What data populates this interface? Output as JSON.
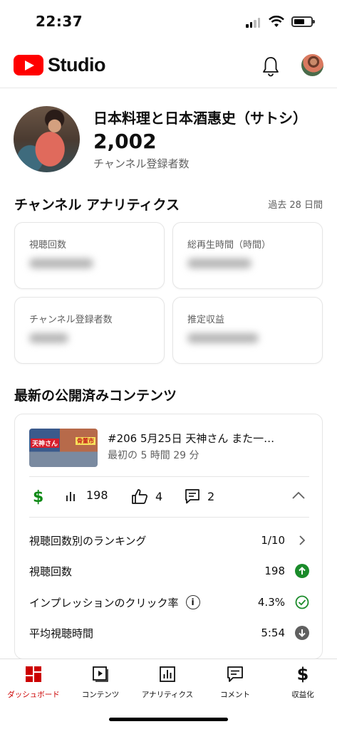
{
  "status_bar": {
    "time": "22:37"
  },
  "header": {
    "logo_text": "Studio"
  },
  "channel": {
    "name": "日本料理と日本酒惠史（サトシ）",
    "subscriber_count": "2,002",
    "subscriber_label": "チャンネル登録者数"
  },
  "analytics": {
    "title": "チャンネル アナリティクス",
    "period": "過去 28 日間",
    "cards": [
      {
        "label": "視聴回数"
      },
      {
        "label": "総再生時間（時間）"
      },
      {
        "label": "チャンネル登録者数"
      },
      {
        "label": "推定収益"
      }
    ]
  },
  "latest": {
    "title": "最新の公開済みコンテンツ",
    "video": {
      "title": "#206  5月25日  天神さん  また一…",
      "subtitle": "最初の 5 時間 29 分",
      "thumb_tag1": "天神さん",
      "thumb_tag2": "骨董市",
      "views": "198",
      "likes": "4",
      "comments": "2"
    },
    "rows": [
      {
        "label": "視聴回数別のランキング",
        "value": "1/10",
        "icon": "chevron-right-icon"
      },
      {
        "label": "視聴回数",
        "value": "198",
        "icon": "arrow-up-icon"
      },
      {
        "label": "インプレッションのクリック率",
        "value": "4.3%",
        "icon": "check-circle-icon"
      },
      {
        "label": "平均視聴時間",
        "value": "5:54",
        "icon": "arrow-down-icon"
      }
    ]
  },
  "bottom_nav": {
    "items": [
      {
        "label": "ダッシュボード",
        "icon": "dashboard-icon",
        "active": true
      },
      {
        "label": "コンテンツ",
        "icon": "content-icon"
      },
      {
        "label": "アナリティクス",
        "icon": "analytics-icon"
      },
      {
        "label": "コメント",
        "icon": "comment-icon"
      },
      {
        "label": "収益化",
        "icon": "monetization-icon"
      }
    ]
  },
  "colors": {
    "brand_red": "#ff0000",
    "active_red": "#cc0000",
    "success_green": "#1a8b2a",
    "money_green": "#0e8a16"
  }
}
